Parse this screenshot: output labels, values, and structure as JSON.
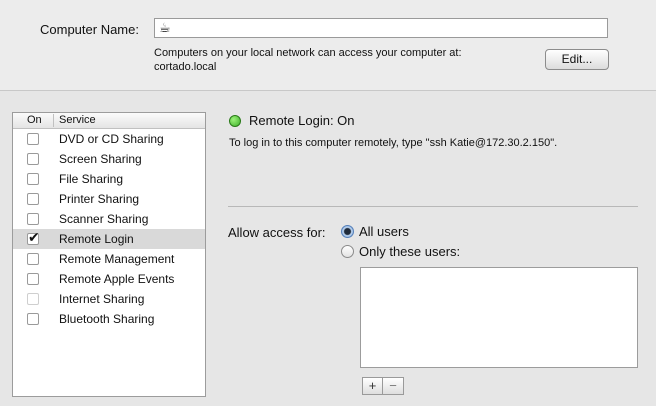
{
  "computer_name": {
    "label": "Computer Name:",
    "value": "☕",
    "description_line1": "Computers on your local network can access your computer at:",
    "description_line2": "cortado.local",
    "edit_button": "Edit..."
  },
  "services": {
    "header_on": "On",
    "header_service": "Service",
    "items": [
      {
        "label": "DVD or CD Sharing",
        "checked": false
      },
      {
        "label": "Screen Sharing",
        "checked": false
      },
      {
        "label": "File Sharing",
        "checked": false
      },
      {
        "label": "Printer Sharing",
        "checked": false
      },
      {
        "label": "Scanner Sharing",
        "checked": false
      },
      {
        "label": "Remote Login",
        "checked": true,
        "selected": true
      },
      {
        "label": "Remote Management",
        "checked": false
      },
      {
        "label": "Remote Apple Events",
        "checked": false
      },
      {
        "label": "Internet Sharing",
        "checked": false,
        "disabled": true
      },
      {
        "label": "Bluetooth Sharing",
        "checked": false
      }
    ]
  },
  "status": {
    "title": "Remote Login: On",
    "indicator_color": "#3cb029",
    "description": "To log in to this computer remotely, type \"ssh Katie@172.30.2.150\"."
  },
  "access": {
    "label": "Allow access for:",
    "option_all": "All users",
    "option_only": "Only these users:",
    "selected": "all"
  },
  "user_list_buttons": {
    "add": "+",
    "remove": "−"
  }
}
